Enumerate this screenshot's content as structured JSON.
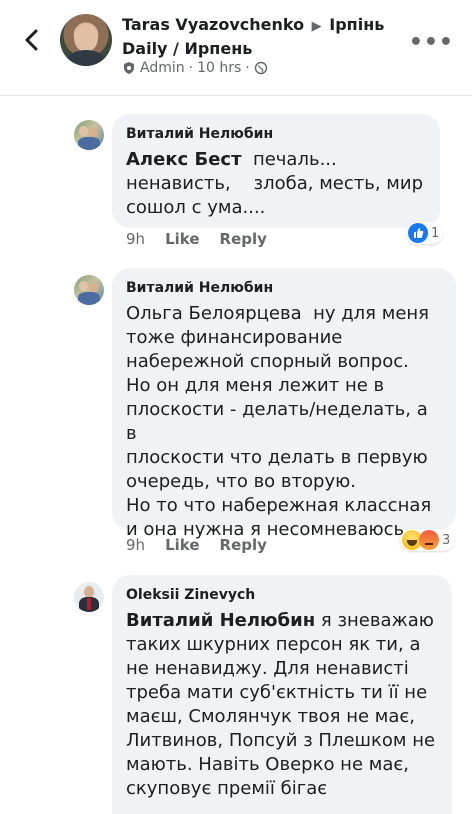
{
  "header": {
    "author": "Taras Vyazovchenko",
    "group": "Ірпінь Daily / Ирпень",
    "role": "Admin",
    "time": "10 hrs"
  },
  "comments": [
    {
      "author": "Виталий Нелюбин",
      "mention": "Алекс Бест",
      "text": "  печаль...\nненависть,    злоба, месть, мир\nсошол с ума....",
      "time": "9h",
      "like_label": "Like",
      "reply_label": "Reply",
      "reaction_count": "1",
      "reactions": [
        "like-icon"
      ]
    },
    {
      "author": "Виталий Нелюбин",
      "mention": "",
      "text": "Ольга Белоярцева  ну для меня\nтоже финансирование\nнабережной спорный вопрос.\nНо он для меня лежит не в\nплоскости - делать/неделать, а в\nплоскости что делать в первую\nочередь, что во вторую.\nНо то что набережная классная\nи она нужна я несомневаюсь.",
      "time": "9h",
      "like_label": "Like",
      "reply_label": "Reply",
      "reaction_count": "3",
      "reactions": [
        "haha-icon",
        "angry-icon"
      ]
    },
    {
      "author": "Oleksii Zinevych",
      "mention": "Виталий Нелюбин",
      "text": " я зневажаю\nтаких шкурних персон як ти, а\nне ненавиджу. Для ненависті\nтреба мати суб'єктність ти її не\nмаєш, Смолянчук твоя не має,\nЛитвинов, Попсуй з Плешком не\nмають. Навіть Оверко не має,\nскуповує премії бігає"
    }
  ],
  "colors": {
    "bubble": "#f0f2f5",
    "secondary_text": "#65676b",
    "like_blue": "#1877f2"
  }
}
